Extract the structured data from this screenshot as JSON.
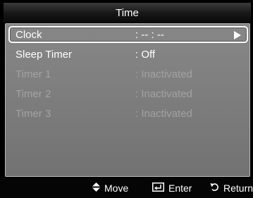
{
  "header": {
    "title": "Time"
  },
  "menu": {
    "items": [
      {
        "label": "Clock",
        "value": ": -- : --",
        "state": "selected",
        "has_submenu": true
      },
      {
        "label": "Sleep Timer",
        "value": ": Off",
        "state": "active"
      },
      {
        "label": "Timer 1",
        "value": ": Inactivated",
        "state": "disabled"
      },
      {
        "label": "Timer 2",
        "value": ": Inactivated",
        "state": "disabled"
      },
      {
        "label": "Timer 3",
        "value": ": Inactivated",
        "state": "disabled"
      }
    ]
  },
  "footer": {
    "move_label": "Move",
    "enter_label": "Enter",
    "return_label": "Return",
    "move_icon": "up-down-arrow-icon",
    "enter_icon": "enter-icon",
    "return_icon": "return-icon"
  },
  "colors": {
    "panel": "#7f7f7f",
    "title_bar": "#1a1a1a",
    "disabled_text": "#a3a3a3",
    "active_text": "#ffffff"
  }
}
